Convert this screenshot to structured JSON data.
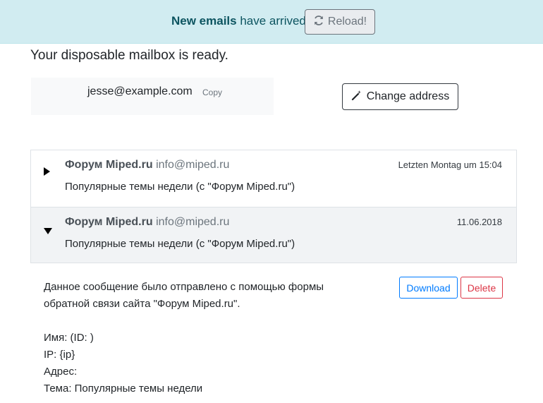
{
  "banner": {
    "bold_text": "New emails",
    "text": " have arrived.",
    "reload_label": "Reload!",
    "reload_icon": "refresh-icon"
  },
  "headline": "Your disposable mailbox is ready.",
  "address": {
    "email": "jesse@example.com",
    "copy_label": "Copy",
    "change_label": "Change address",
    "change_icon": "magic-wand-icon"
  },
  "mails": [
    {
      "sender_name": "Форум Miped.ru",
      "sender_email": "info@miped.ru",
      "date": "Letzten Montag um 15:04",
      "subject": "Популярные темы недели (с \"Форум Miped.ru\")",
      "expanded": false
    },
    {
      "sender_name": "Форум Miped.ru",
      "sender_email": "info@miped.ru",
      "date": "11.06.2018",
      "subject": "Популярные темы недели (с \"Форум Miped.ru\")",
      "expanded": true
    }
  ],
  "message": {
    "line1": "Данное сообщение было отправлено с помощью формы",
    "line2": "обратной связи сайта \"Форум Miped.ru\".",
    "name_line": "Имя: (ID: )",
    "ip_line": "IP: {ip}",
    "address_line": "Адрес:",
    "topic_line": "Тема: Популярные темы недели",
    "download_label": "Download",
    "delete_label": "Delete"
  },
  "colors": {
    "banner_bg": "#d1ecf1",
    "primary": "#007bff",
    "danger": "#dc3545"
  }
}
